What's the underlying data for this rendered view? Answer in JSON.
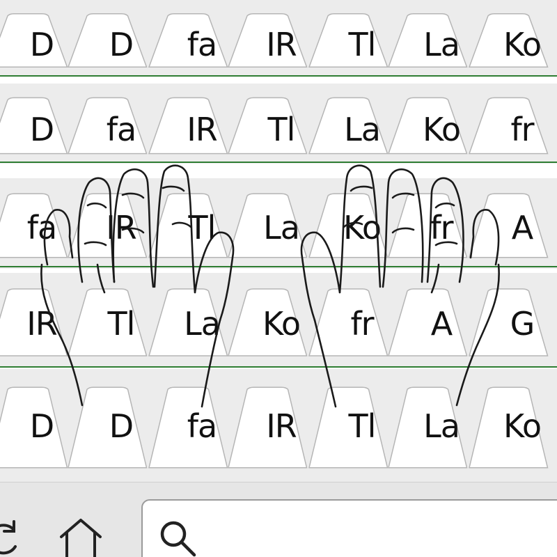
{
  "tab_rows": [
    {
      "labels": [
        "D",
        "D",
        "fa",
        "IR",
        "Tl",
        "La",
        "Ko"
      ]
    },
    {
      "labels": [
        "D",
        "fa",
        "IR",
        "Tl",
        "La",
        "Ko",
        "fr"
      ]
    },
    {
      "labels": [
        "fa",
        "IR",
        "Tl",
        "La",
        "Ko",
        "fr",
        "A"
      ]
    },
    {
      "labels": [
        "IR",
        "Tl",
        "La",
        "Ko",
        "fr",
        "A",
        "G"
      ]
    },
    {
      "labels": [
        "D",
        "D",
        "fa",
        "IR",
        "Tl",
        "La",
        "Ko"
      ]
    }
  ],
  "toolbar": {
    "reload_icon": "reload-icon",
    "home_icon": "home-icon",
    "search_icon": "search-icon",
    "search_value": ""
  },
  "colors": {
    "tab_fill": "#ffffff",
    "tab_outline": "#b5b5b5",
    "tab_strip": "#ececec",
    "row_underline": "#2e7d32",
    "toolbar": "#e6e6e6"
  }
}
